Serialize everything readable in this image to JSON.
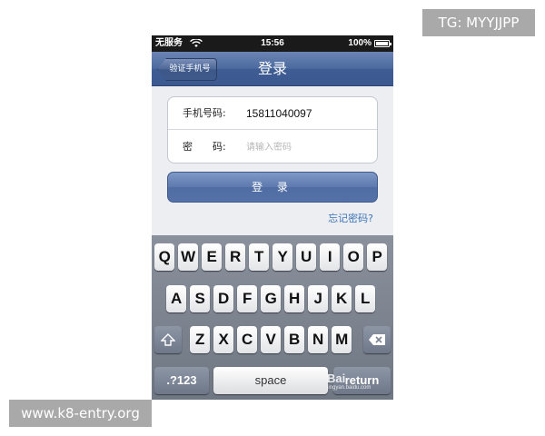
{
  "watermarks": {
    "top": "TG: MYYJJPP",
    "bottom": "www.k8-entry.org",
    "baidu": "Bai",
    "baidu_sub": "jingyan.baidu.com"
  },
  "status_bar": {
    "carrier": "无服务",
    "time": "15:56",
    "battery": "100%"
  },
  "nav": {
    "back_label": "验证手机号",
    "title": "登录"
  },
  "form": {
    "phone_label": "手机号码:",
    "phone_value": "15811040097",
    "password_label": "密　　码:",
    "password_placeholder": "请输入密码"
  },
  "login_button": "登 录",
  "forgot_link": "忘记密码?",
  "keyboard": {
    "row1": [
      "Q",
      "W",
      "E",
      "R",
      "T",
      "Y",
      "U",
      "I",
      "O",
      "P"
    ],
    "row2": [
      "A",
      "S",
      "D",
      "F",
      "G",
      "H",
      "J",
      "K",
      "L"
    ],
    "row3": [
      "Z",
      "X",
      "C",
      "V",
      "B",
      "N",
      "M"
    ],
    "numbers_label": ".?123",
    "space_label": "space",
    "return_label": "return",
    "shift_icon": "shift-arrow-icon",
    "delete_icon": "backspace-icon"
  },
  "colors": {
    "nav_blue": "#4c6a9f",
    "link_blue": "#3e74b8",
    "keyboard_gray": "#7b838f"
  }
}
